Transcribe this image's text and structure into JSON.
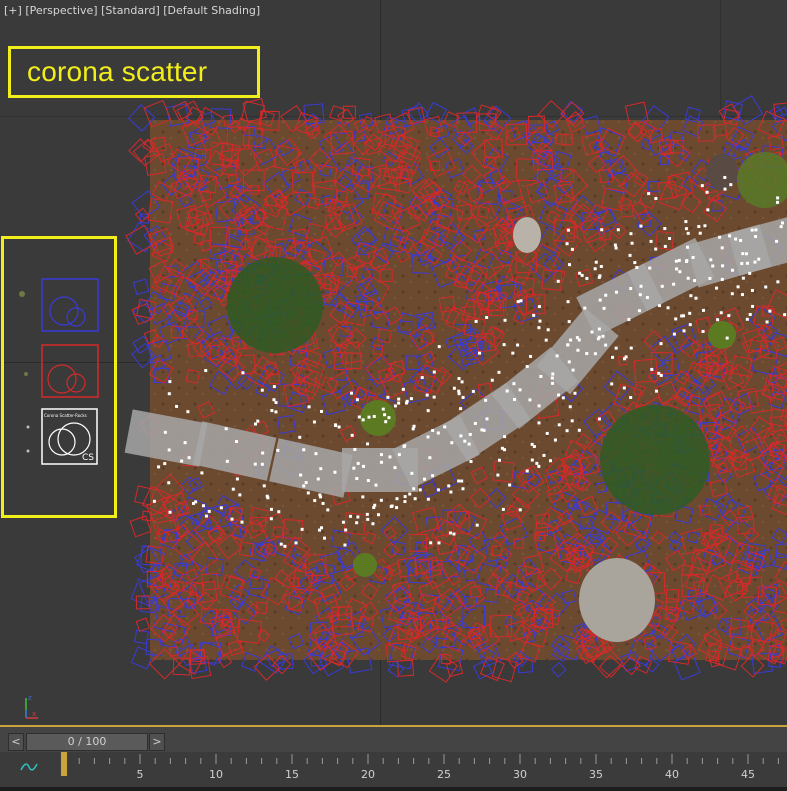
{
  "viewport": {
    "labels": [
      "[+]",
      "[Perspective]",
      "[Standard]",
      "[Default Shading]"
    ],
    "title": "corona scatter",
    "legend": {
      "items": [
        {
          "color": "#3a3ad6",
          "icon": "blue-scatter-icon"
        },
        {
          "color": "#d42a2a",
          "icon": "red-scatter-icon"
        },
        {
          "color": "#ffffff",
          "icon": "corona-scatter-icon",
          "caption": "Corona Scatter-Rocks",
          "badge": "CS"
        }
      ]
    },
    "colors": {
      "highlight": "#f2ee1b",
      "ground": "#6b4a30",
      "stone": "#a7a7a7"
    },
    "axis": {
      "x": "x",
      "z": "z"
    }
  },
  "timeslider": {
    "prev": "<",
    "next": ">",
    "frame": "0 / 100",
    "ticks": [
      "5",
      "10",
      "15",
      "20",
      "25",
      "30",
      "35",
      "40",
      "45"
    ]
  }
}
